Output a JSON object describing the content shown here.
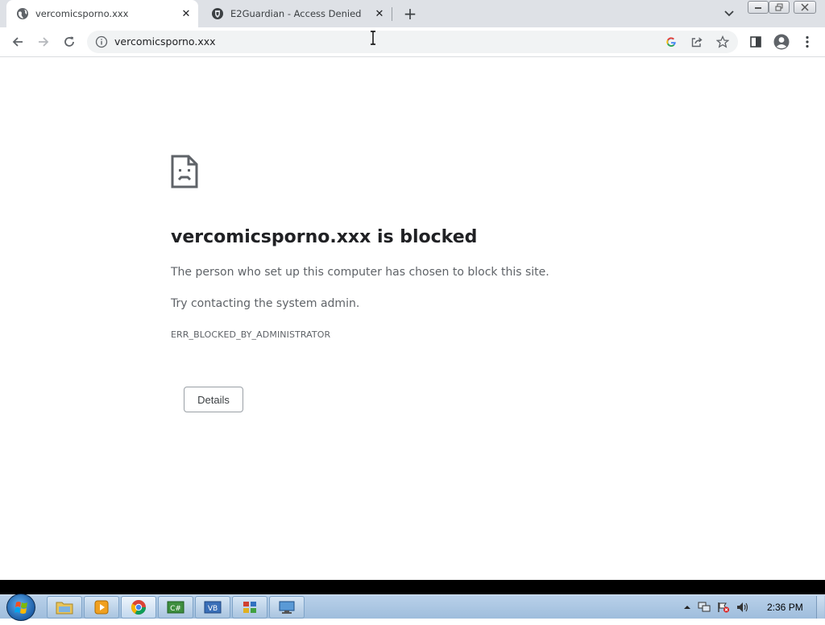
{
  "browser": {
    "tabs": [
      {
        "title": "vercomicsporno.xxx",
        "active": true,
        "icon": "globe-icon"
      },
      {
        "title": "E2Guardian - Access Denied",
        "active": false,
        "icon": "e2guardian-shield-icon"
      }
    ],
    "new_tab_icon": "plus-icon",
    "tab_search_icon": "chevron-down-icon",
    "window_controls": [
      "minimize-icon",
      "restore-icon",
      "close-icon"
    ],
    "toolbar": {
      "back_icon": "back-arrow-icon",
      "forward_icon": "forward-arrow-icon",
      "reload_icon": "reload-icon",
      "site_info_icon": "info-icon",
      "url": "vercomicsporno.xxx",
      "omnibox_icons": [
        "google-g-icon",
        "share-icon",
        "bookmark-star-icon"
      ],
      "side_panel_icon": "side-panel-icon",
      "profile_icon": "profile-avatar-icon",
      "menu_icon": "kebab-menu-icon"
    }
  },
  "error_page": {
    "icon": "sad-document-icon",
    "title": "vercomicsporno.xxx is blocked",
    "message": "The person who set up this computer has chosen to block this site.",
    "suggestion": "Try contacting the system admin.",
    "error_code": "ERR_BLOCKED_BY_ADMINISTRATOR",
    "details_label": "Details"
  },
  "taskbar": {
    "start_icon": "windows-start-orb-icon",
    "apps": [
      {
        "name": "file-explorer-icon",
        "active": false
      },
      {
        "name": "media-player-icon",
        "active": false
      },
      {
        "name": "chrome-icon",
        "active": true
      },
      {
        "name": "csharp-app-icon",
        "active": false
      },
      {
        "name": "vb-app-icon",
        "active": false
      },
      {
        "name": "control-panel-icon",
        "active": false
      },
      {
        "name": "remote-desktop-icon",
        "active": false
      }
    ],
    "tray_icons": [
      "show-hidden-icons-arrow",
      "network-icon",
      "action-center-flag-icon",
      "volume-icon"
    ],
    "clock": "2:36 PM"
  }
}
